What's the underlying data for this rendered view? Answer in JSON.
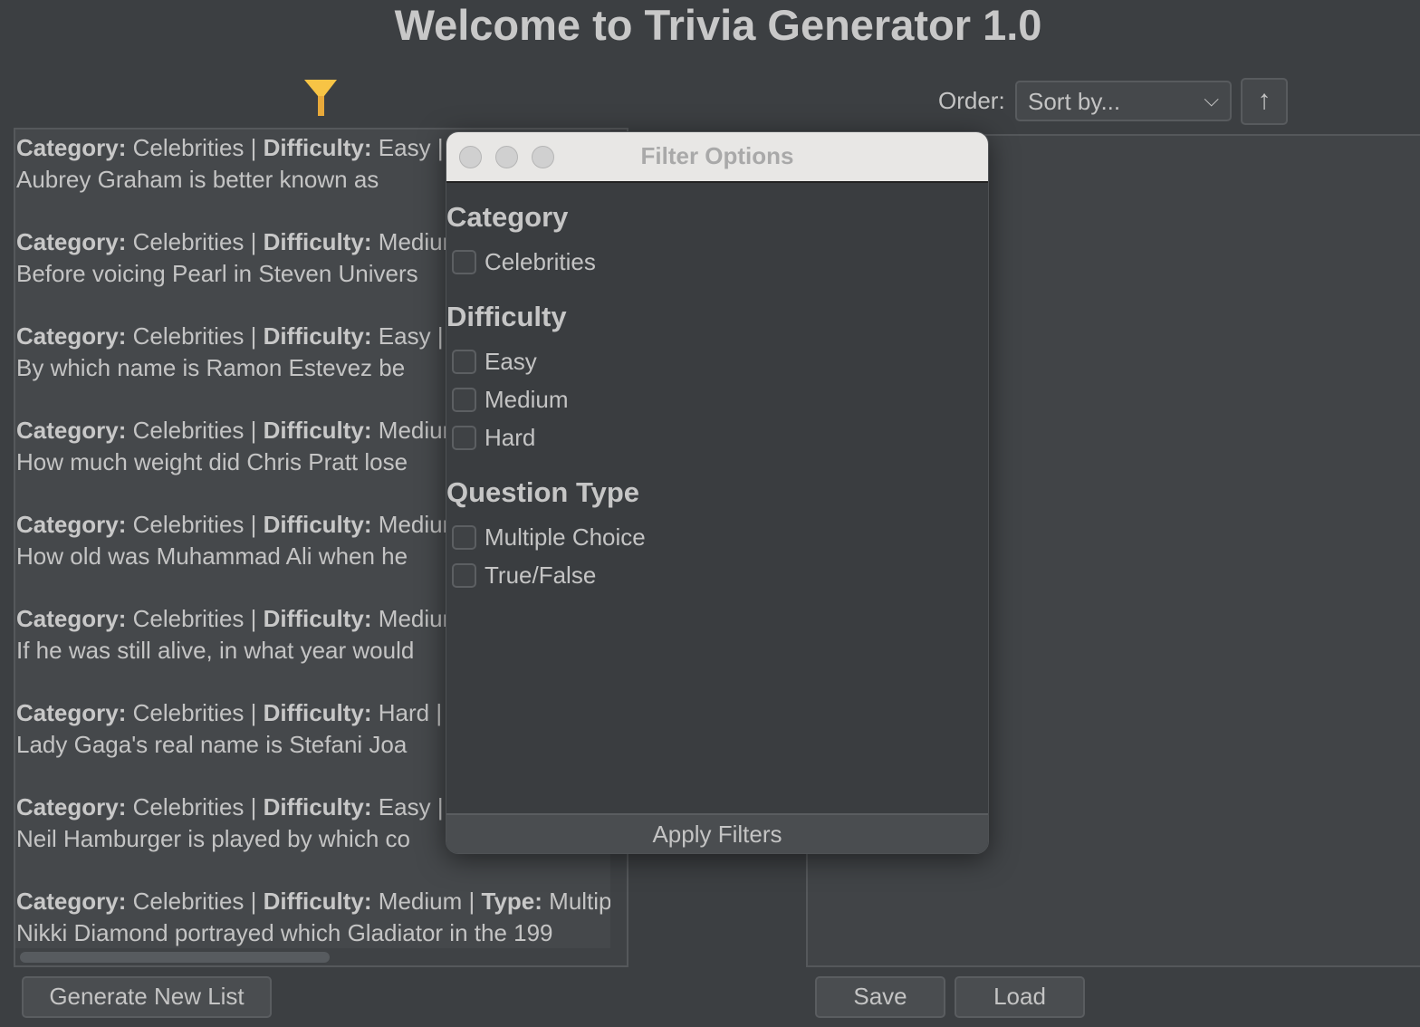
{
  "title": "Welcome to Trivia Generator 1.0",
  "filter_icon": {
    "name": "funnel-icon",
    "color": "#f7c445"
  },
  "labels": {
    "category": "Category:",
    "difficulty": "Difficulty:",
    "type": "Type:",
    "sep": "|"
  },
  "questions": [
    {
      "category": "Celebrities",
      "difficulty": "Easy",
      "question": "Aubrey Graham is better known as"
    },
    {
      "category": "Celebrities",
      "difficulty": "Medium",
      "question": "Before voicing Pearl in Steven Univers"
    },
    {
      "category": "Celebrities",
      "difficulty": "Easy",
      "question": "By which name is Ramon Estevez be"
    },
    {
      "category": "Celebrities",
      "difficulty": "Medium",
      "question": "How much weight did Chris Pratt lose"
    },
    {
      "category": "Celebrities",
      "difficulty": "Medium",
      "question": "How old was Muhammad Ali when he"
    },
    {
      "category": "Celebrities",
      "difficulty": "Medium",
      "question": "If he was still alive, in what year would"
    },
    {
      "category": "Celebrities",
      "difficulty": "Hard",
      "question": "Lady Gaga's real name is Stefani Joa"
    },
    {
      "category": "Celebrities",
      "difficulty": "Easy",
      "question": "Neil Hamburger is played by which co"
    },
    {
      "category": "Celebrities",
      "difficulty": "Medium",
      "type": "Multip",
      "question": "Nikki Diamond portrayed which Gladiator in the 199"
    }
  ],
  "order": {
    "label": "Order:",
    "selected": "Sort by...",
    "chevron": "⌵",
    "direction_icon": "↑"
  },
  "buttons": {
    "generate": "Generate New List",
    "save": "Save",
    "load": "Load"
  },
  "dialog": {
    "title": "Filter Options",
    "sections": [
      {
        "heading": "Category",
        "options": [
          {
            "label": "Celebrities",
            "checked": false
          }
        ]
      },
      {
        "heading": "Difficulty",
        "options": [
          {
            "label": "Easy",
            "checked": false
          },
          {
            "label": "Medium",
            "checked": false
          },
          {
            "label": "Hard",
            "checked": false
          }
        ]
      },
      {
        "heading": "Question Type",
        "options": [
          {
            "label": "Multiple Choice",
            "checked": false
          },
          {
            "label": "True/False",
            "checked": false
          }
        ]
      }
    ],
    "apply": "Apply Filters"
  }
}
